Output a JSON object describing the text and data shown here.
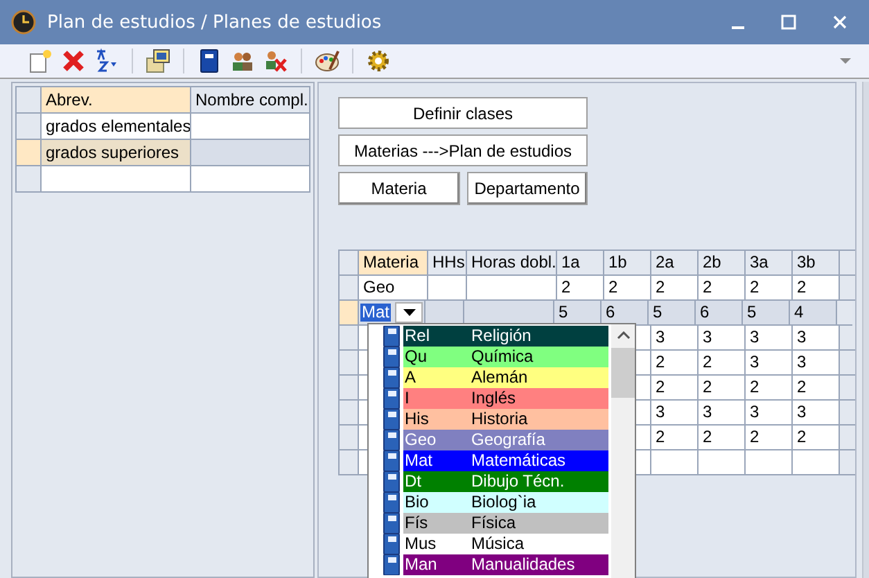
{
  "window": {
    "title": "Plan de estudios / Planes de estudios"
  },
  "groups_table": {
    "columns": [
      "Abrev.",
      "Nombre compl."
    ],
    "rows": [
      {
        "cells": [
          "grados elementales"
        ],
        "selected": false
      },
      {
        "cells": [
          "grados superiores"
        ],
        "selected": true
      },
      {
        "selected": false
      }
    ]
  },
  "buttons": [
    {
      "label": "Definir clases",
      "kind": "wide"
    },
    {
      "label": "Materias --->Plan de estudios",
      "kind": "wide"
    },
    {
      "label": "Materia",
      "kind": "half"
    },
    {
      "label": "Departamento",
      "kind": "half"
    }
  ],
  "plan_table": {
    "columns": [
      "Materia",
      "HHs",
      "Horas dobl.",
      "1a",
      "1b",
      "2a",
      "2b",
      "3a",
      "3b"
    ],
    "rows": [
      {
        "materia": "Geo",
        "values": [
          "2",
          "2",
          "2",
          "2",
          "2",
          "2"
        ],
        "selected": false,
        "editing": false
      },
      {
        "materia": "Mat",
        "values": [
          "5",
          "6",
          "5",
          "6",
          "5",
          "4"
        ],
        "selected": true,
        "editing": true
      },
      {
        "values": [
          "3",
          "3",
          "3",
          "3"
        ],
        "selected": false,
        "editing": false
      },
      {
        "values": [
          "2",
          "2",
          "3",
          "3"
        ],
        "selected": false,
        "editing": false
      },
      {
        "values": [
          "2",
          "2",
          "2",
          "2"
        ],
        "selected": false,
        "editing": false
      },
      {
        "values": [
          "3",
          "3",
          "3",
          "3"
        ],
        "selected": false,
        "editing": false
      },
      {
        "values": [
          "2",
          "2",
          "2",
          "2"
        ],
        "selected": false,
        "editing": false
      },
      {
        "selected": false,
        "editing": false
      }
    ]
  },
  "subject_dropdown": {
    "items": [
      {
        "abbr": "Rel",
        "name": "Religión",
        "color": "#004040"
      },
      {
        "abbr": "Qu",
        "name": "Química",
        "color": "#80ff80"
      },
      {
        "abbr": "A",
        "name": "Alemán",
        "color": "#ffff80"
      },
      {
        "abbr": "I",
        "name": "Inglés",
        "color": "#ff8080"
      },
      {
        "abbr": "His",
        "name": "Historia",
        "color": "#ffc0a0"
      },
      {
        "abbr": "Geo",
        "name": "Geografía",
        "color": "#8080c0"
      },
      {
        "abbr": "Mat",
        "name": "Matemáticas",
        "color": "#0000ff"
      },
      {
        "abbr": "Dt",
        "name": "Dibujo Técn.",
        "color": "#008000"
      },
      {
        "abbr": "Bio",
        "name": "Biolog`ia",
        "color": "#d0ffff"
      },
      {
        "abbr": "Fís",
        "name": "Física",
        "color": "#c0c0c0"
      },
      {
        "abbr": "Mus",
        "name": "Música",
        "color": "#ffffff"
      },
      {
        "abbr": "Man",
        "name": "Manualidades",
        "color": "#800080"
      }
    ]
  }
}
